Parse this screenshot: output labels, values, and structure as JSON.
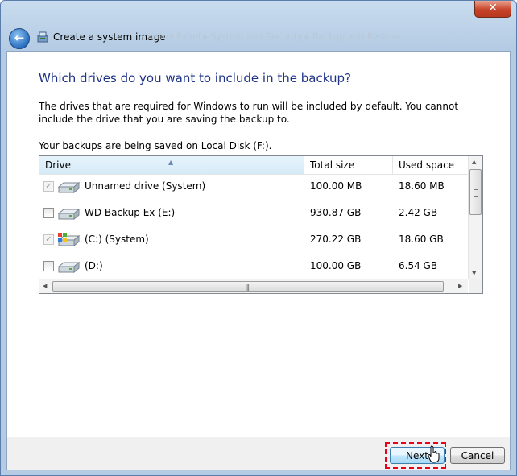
{
  "window": {
    "title": "Create a system image",
    "breadcrumb_faded": "Control Panel  ▸  System and Security  ▸  Backup and Restore",
    "close_label": "✕"
  },
  "main": {
    "heading": "Which drives do you want to include in the backup?",
    "description": "The drives that are required for Windows to run will be included by default. You cannot include the drive that you are saving the backup to.",
    "saving_note": "Your backups are being saved on Local Disk (F:)."
  },
  "drive_list": {
    "columns": [
      "Drive",
      "Total size",
      "Used space"
    ],
    "rows": [
      {
        "name": "Unnamed drive (System)",
        "total": "100.00 MB",
        "used": "18.60 MB",
        "checked": true,
        "disabled": true,
        "icon": "hard-drive-icon"
      },
      {
        "name": "WD Backup Ex  (E:)",
        "total": "930.87 GB",
        "used": "2.42 GB",
        "checked": false,
        "disabled": false,
        "icon": "hard-drive-icon"
      },
      {
        "name": "(C:) (System)",
        "total": "270.22 GB",
        "used": "18.60 GB",
        "checked": true,
        "disabled": true,
        "icon": "windows-drive-icon"
      },
      {
        "name": "(D:)",
        "total": "100.00 GB",
        "used": "6.54 GB",
        "checked": false,
        "disabled": false,
        "icon": "hard-drive-icon"
      }
    ]
  },
  "footer": {
    "next_label": "Next",
    "cancel_label": "Cancel"
  },
  "colors": {
    "heading": "#1e3287",
    "highlight": "#e8001c"
  }
}
